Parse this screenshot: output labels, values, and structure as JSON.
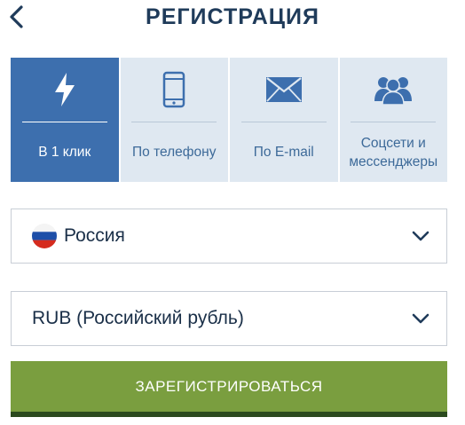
{
  "header": {
    "title": "РЕГИСТРАЦИЯ",
    "back_icon": "chevron-left-icon"
  },
  "tabs": [
    {
      "label": "В 1 клик",
      "icon": "lightning-icon",
      "active": true
    },
    {
      "label": "По телефону",
      "icon": "phone-icon",
      "active": false
    },
    {
      "label": "По E-mail",
      "icon": "envelope-icon",
      "active": false
    },
    {
      "label": "Соцсети и мессенджеры",
      "icon": "users-icon",
      "active": false
    }
  ],
  "country_select": {
    "value": "Россия",
    "flag_icon": "russia-flag-icon"
  },
  "currency_select": {
    "value": "RUB (Российский рубль)"
  },
  "submit_button": {
    "label": "ЗАРЕГИСТРИРОВАТЬСЯ"
  },
  "colors": {
    "accent": "#3d6fae",
    "tab_bg": "#dfe8f1",
    "button": "#7a9e3f",
    "title": "#1f3b5a"
  }
}
